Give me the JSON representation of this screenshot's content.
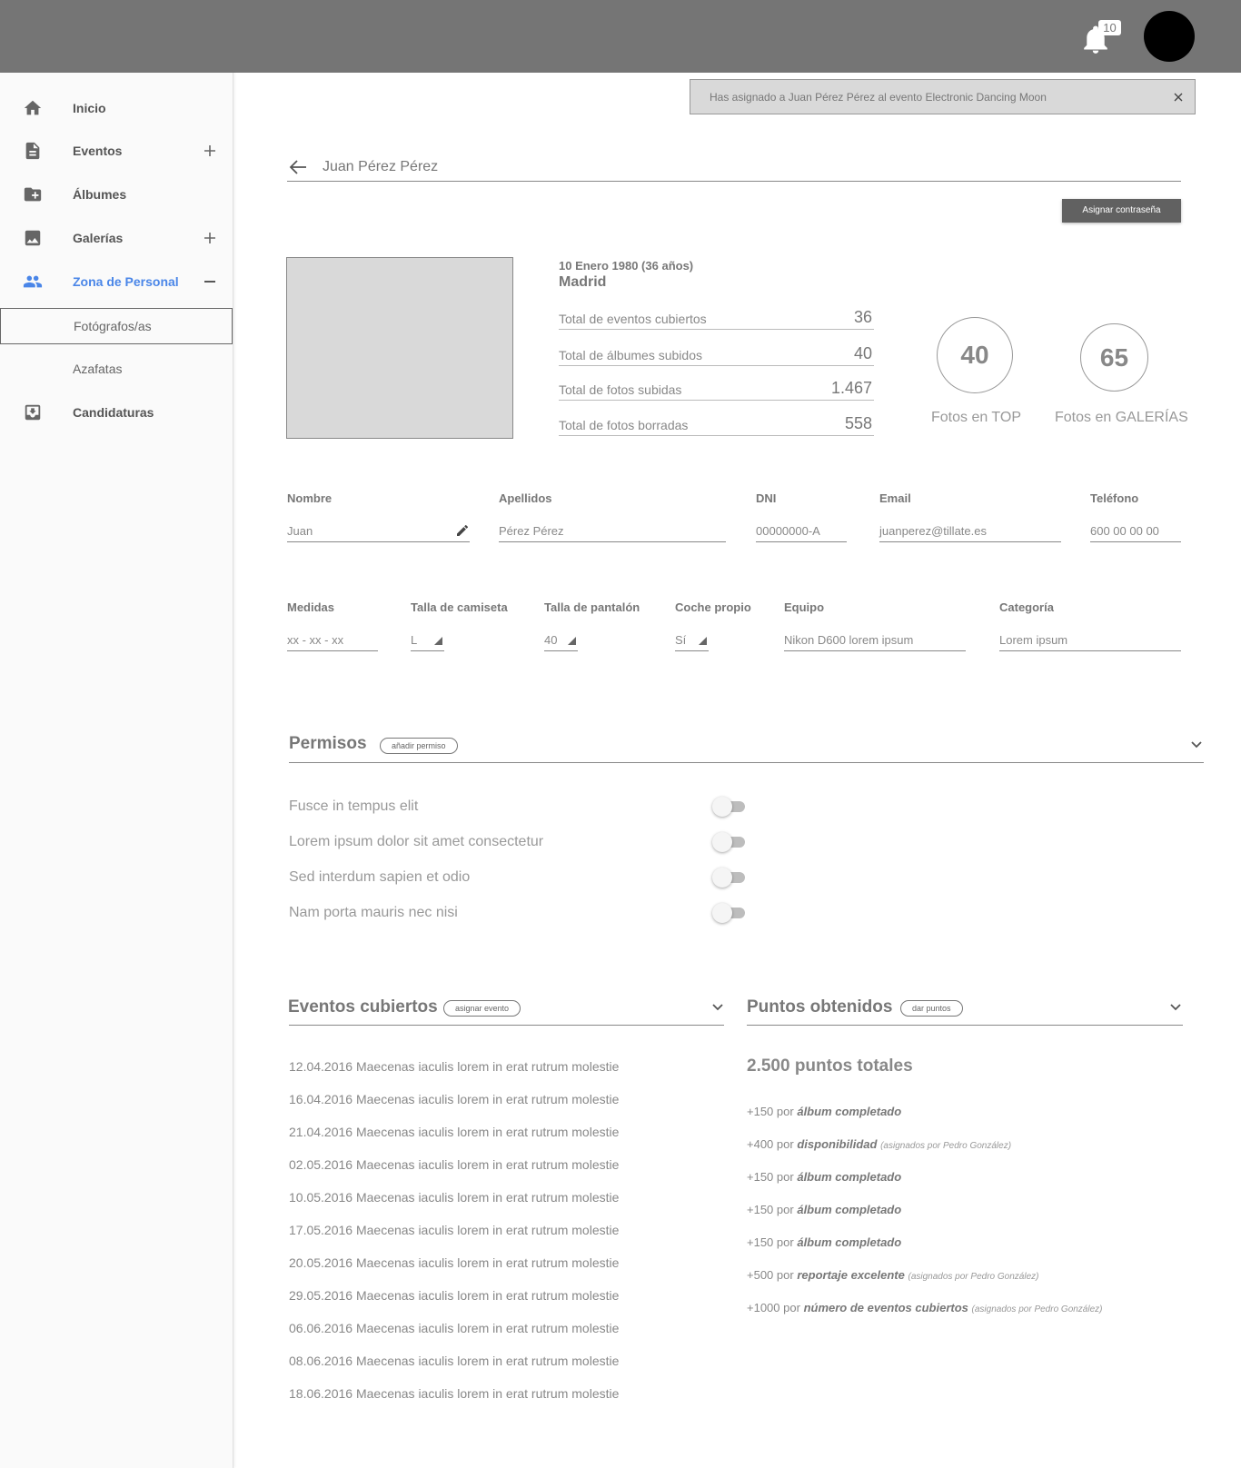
{
  "header": {
    "notifications_count": "10"
  },
  "sidebar": {
    "items": [
      {
        "label": "Inicio",
        "icon": "home-icon"
      },
      {
        "label": "Eventos",
        "icon": "document-icon",
        "toggle": "plus"
      },
      {
        "label": "Álbumes",
        "icon": "folder-add-icon"
      },
      {
        "label": "Galerías",
        "icon": "image-icon",
        "toggle": "plus"
      },
      {
        "label": "Zona de Personal",
        "icon": "people-icon",
        "toggle": "minus",
        "active": true
      },
      {
        "label": "Candidaturas",
        "icon": "inbox-download-icon"
      }
    ],
    "sub_items": [
      {
        "label": "Fotógrafos/as",
        "selected": true
      },
      {
        "label": "Azafatas",
        "selected": false
      }
    ],
    "active_color": "#4a86e8"
  },
  "toast": {
    "message": "Has asignado a Juan Pérez Pérez al evento Electronic Dancing Moon"
  },
  "profile": {
    "name": "Juan Pérez Pérez",
    "assign_password_label": "Asignar contraseña",
    "birth": "10 Enero 1980 (36 años)",
    "city": "Madrid",
    "stats": [
      {
        "label": "Total de eventos cubiertos",
        "value": "36"
      },
      {
        "label": "Total de álbumes subidos",
        "value": "40"
      },
      {
        "label": "Total de fotos subidas",
        "value": "1.467"
      },
      {
        "label": "Total de fotos borradas",
        "value": "558"
      }
    ],
    "highlights": [
      {
        "value": "40",
        "label": "Fotos en TOP"
      },
      {
        "value": "65",
        "label": "Fotos en GALERÍAS"
      }
    ]
  },
  "form": {
    "row1": [
      {
        "label": "Nombre",
        "value": "Juan",
        "editable_icon": "pencil-icon"
      },
      {
        "label": "Apellidos",
        "value": "Pérez Pérez"
      },
      {
        "label": "DNI",
        "value": "00000000-A"
      },
      {
        "label": "Email",
        "value": "juanperez@tillate.es"
      },
      {
        "label": "Teléfono",
        "value": "600 00 00 00"
      }
    ],
    "row2": [
      {
        "label": "Medidas",
        "value": "xx - xx - xx"
      },
      {
        "label": "Talla de camiseta",
        "value": "L",
        "select": true
      },
      {
        "label": "Talla de pantalón",
        "value": "40",
        "select": true
      },
      {
        "label": "Coche propio",
        "value": "Sí",
        "select": true
      },
      {
        "label": "Equipo",
        "value": "Nikon D600 lorem ipsum"
      },
      {
        "label": "Categoría",
        "value": "Lorem ipsum"
      }
    ]
  },
  "permisos": {
    "title": "Permisos",
    "add_label": "añadir permiso",
    "items": [
      {
        "label": "Fusce in tempus elit",
        "enabled": false
      },
      {
        "label": "Lorem ipsum dolor sit amet consectetur",
        "enabled": false
      },
      {
        "label": "Sed interdum sapien et odio",
        "enabled": false
      },
      {
        "label": "Nam porta mauris nec nisi",
        "enabled": false
      }
    ]
  },
  "eventos": {
    "title": "Eventos cubiertos",
    "add_label": "asignar evento",
    "items": [
      "12.04.2016 Maecenas iaculis lorem in erat rutrum molestie",
      "16.04.2016 Maecenas iaculis lorem in erat rutrum molestie",
      "21.04.2016 Maecenas iaculis lorem in erat rutrum molestie",
      "02.05.2016 Maecenas iaculis lorem in erat rutrum molestie",
      "10.05.2016 Maecenas iaculis lorem in erat rutrum molestie",
      "17.05.2016 Maecenas iaculis lorem in erat rutrum molestie",
      "20.05.2016 Maecenas iaculis lorem in erat rutrum molestie",
      "29.05.2016 Maecenas iaculis lorem in erat rutrum molestie",
      "06.06.2016 Maecenas iaculis lorem in erat rutrum molestie",
      "08.06.2016 Maecenas iaculis lorem in erat rutrum molestie",
      "18.06.2016 Maecenas iaculis lorem in erat rutrum molestie"
    ]
  },
  "puntos": {
    "title": "Puntos obtenidos",
    "add_label": "dar puntos",
    "total": "2.500 puntos totales",
    "items": [
      {
        "amount": "+150",
        "por": "por",
        "reason": "álbum completado",
        "by": ""
      },
      {
        "amount": "+400",
        "por": "por",
        "reason": "disponibilidad",
        "by": "(asignados por Pedro González)"
      },
      {
        "amount": "+150",
        "por": "por",
        "reason": "álbum completado",
        "by": ""
      },
      {
        "amount": "+150",
        "por": "por",
        "reason": "álbum completado",
        "by": ""
      },
      {
        "amount": "+150",
        "por": "por",
        "reason": "álbum completado",
        "by": ""
      },
      {
        "amount": "+500",
        "por": "por",
        "reason": "reportaje excelente",
        "by": "(asignados por Pedro González)"
      },
      {
        "amount": "+1000",
        "por": "por",
        "reason": "número de eventos cubiertos",
        "by": "(asignados por Pedro González)"
      }
    ]
  }
}
